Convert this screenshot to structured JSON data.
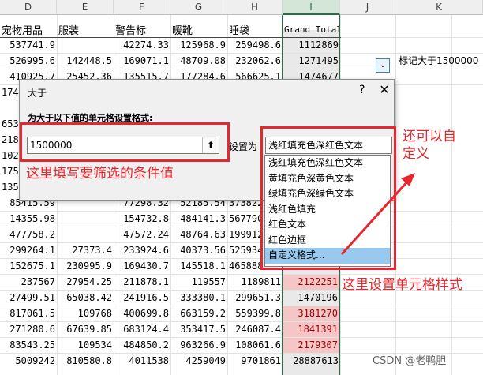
{
  "columns": [
    "D",
    "E",
    "F",
    "G",
    "H",
    "I",
    "J",
    "K"
  ],
  "header_row": [
    "宠物用品",
    "服装",
    "警告标",
    "暖靴",
    "睡袋",
    "Grand Total"
  ],
  "rows": [
    [
      "537741.9",
      "",
      "42274.33",
      "125968.9",
      "259498.6",
      "1112869"
    ],
    [
      "526995.6",
      "142448.5",
      "169071.1",
      "48709.08",
      "232062.6",
      "1271495"
    ],
    [
      "410925.7",
      "25452.36",
      "135515.7",
      "177284.6",
      "566625.1",
      "1474677"
    ],
    [
      "85415.59",
      "",
      "77298.32",
      "52185.54",
      "373822",
      ""
    ],
    [
      "14355.98",
      "",
      "154732.8",
      "484141.3",
      "567790",
      ""
    ],
    [
      "477758.2",
      "",
      "47572.24",
      "48764.63",
      "199912",
      ""
    ],
    [
      "299264.1",
      "27373.4",
      "233924.6",
      "40373.56",
      "525934",
      ""
    ],
    [
      "152675.1",
      "230995.9",
      "169430.7",
      "145518.1",
      "465888",
      ""
    ],
    [
      "237567",
      "27954.25",
      "211878.1",
      "119557",
      "1189811",
      "2122251"
    ],
    [
      "27499.51",
      "65038.42",
      "241916.5",
      "333380.1",
      "299651.3",
      "1470196"
    ],
    [
      "817061.5",
      "109768",
      "400699.8",
      "663159.2",
      "559399.8",
      "3181270"
    ],
    [
      "271280.6",
      "67639.85",
      "683124.4",
      "353417.5",
      "246087.4",
      "1841391"
    ],
    [
      "83543.25",
      "109534",
      "484850.2",
      "963266.9",
      "108061.6",
      "2179307"
    ],
    [
      "5009242",
      "810580.8",
      "4011538",
      "4259049",
      "9701861",
      "28887613"
    ]
  ],
  "hidden_row_stubs": [
    "174",
    "653",
    "218",
    "102",
    "175",
    "135"
  ],
  "note_text": "标记大于1500000",
  "dialog": {
    "title": "大于",
    "help": "?",
    "close": "✕",
    "instruction": "为大于以下值的单元格设置格式:",
    "input_value": "1500000",
    "collapse_icon": "⬆",
    "set_label": "设置为",
    "select_value": "浅红填充色深红色文本",
    "chevron": "⌄"
  },
  "dropdown_options": [
    "浅红填充色深红色文本",
    "黄填充色深黄色文本",
    "绿填充色深绿色文本",
    "浅红色填充",
    "红色文本",
    "红色边框",
    "自定义格式..."
  ],
  "annotations": {
    "input_hint": "这里填写要筛选的条件值",
    "custom_hint_line1": "还可以自",
    "custom_hint_line2": "定义",
    "style_hint": "这里设置单元格样式"
  },
  "watermark": "CSDN @老鸭胆",
  "colors": {
    "accent": "#217346",
    "highlight_fill": "#f4c6c6",
    "highlight_text": "#9c0006",
    "annotation": "#e8262c",
    "selected_option": "#99c9ef"
  }
}
